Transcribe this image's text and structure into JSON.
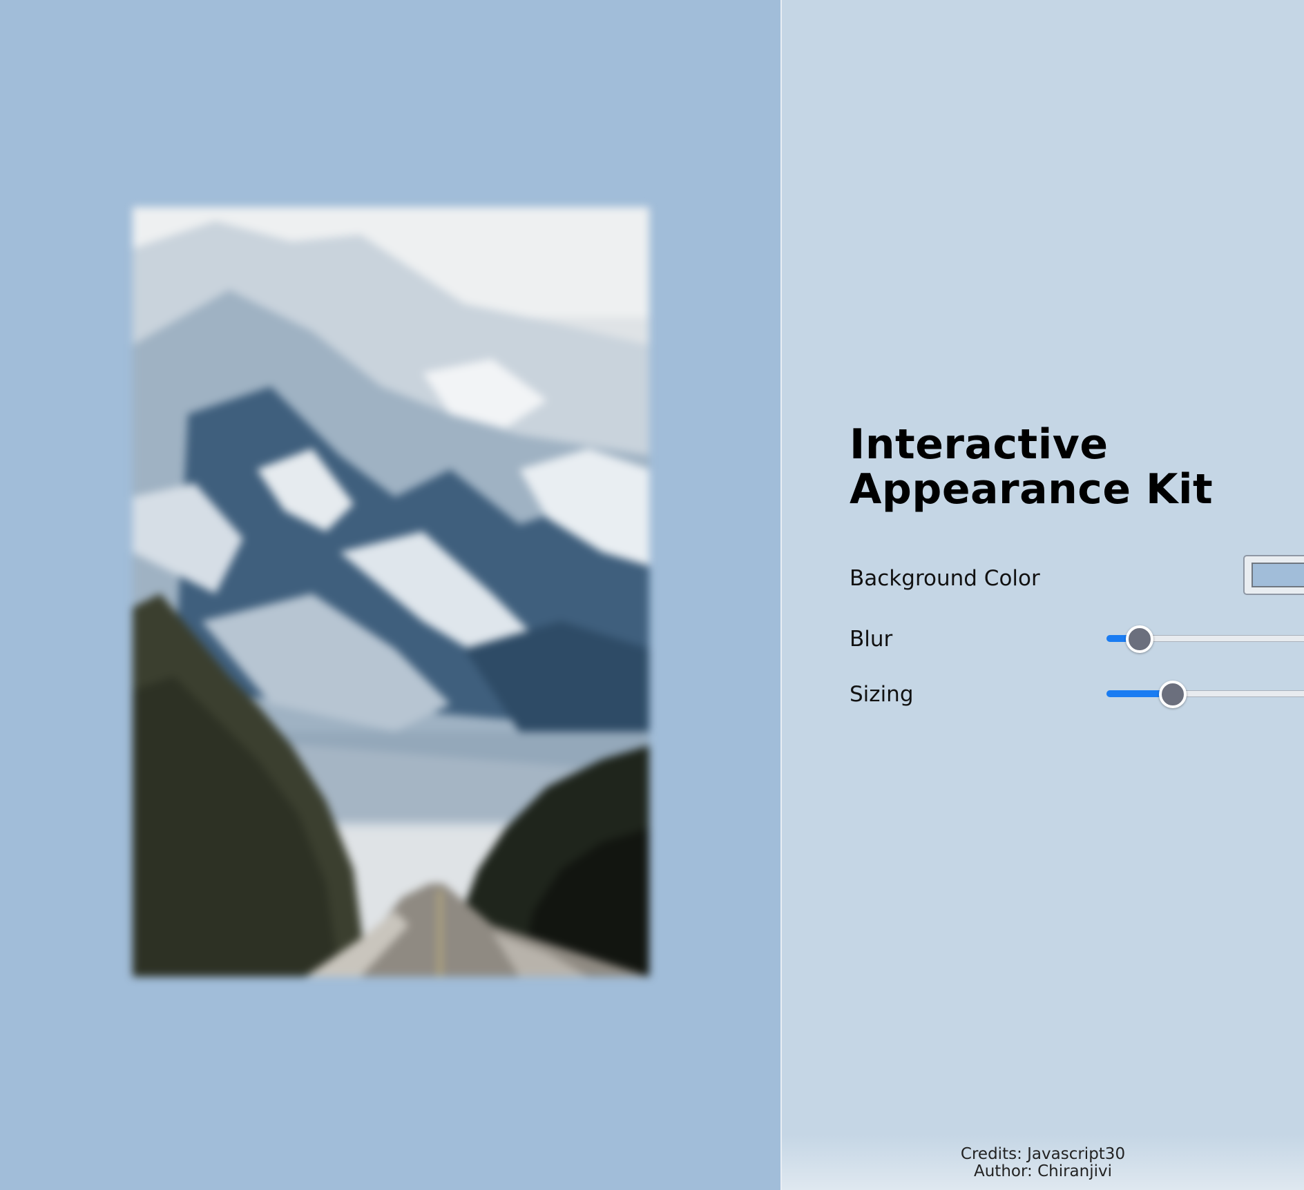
{
  "panel": {
    "title_line1": "Interactive",
    "title_line2": "Appearance Kit"
  },
  "controls": {
    "background_color": {
      "label": "Background Color",
      "value": "#a1bdd9"
    },
    "blur": {
      "label": "Blur",
      "value_fraction": 0.15
    },
    "sizing": {
      "label": "Sizing",
      "value_fraction": 0.3
    }
  },
  "footer": {
    "credits": "Credits: Javascript30",
    "author": "Author: Chiranjivi"
  },
  "colors": {
    "page_background": "#a1bdd9",
    "panel_background": "#c5d6e5",
    "slider_fill": "#1a7cf2",
    "slider_thumb": "#6b6f7d"
  },
  "image": {
    "subject": "snowy mountain and road photo"
  }
}
